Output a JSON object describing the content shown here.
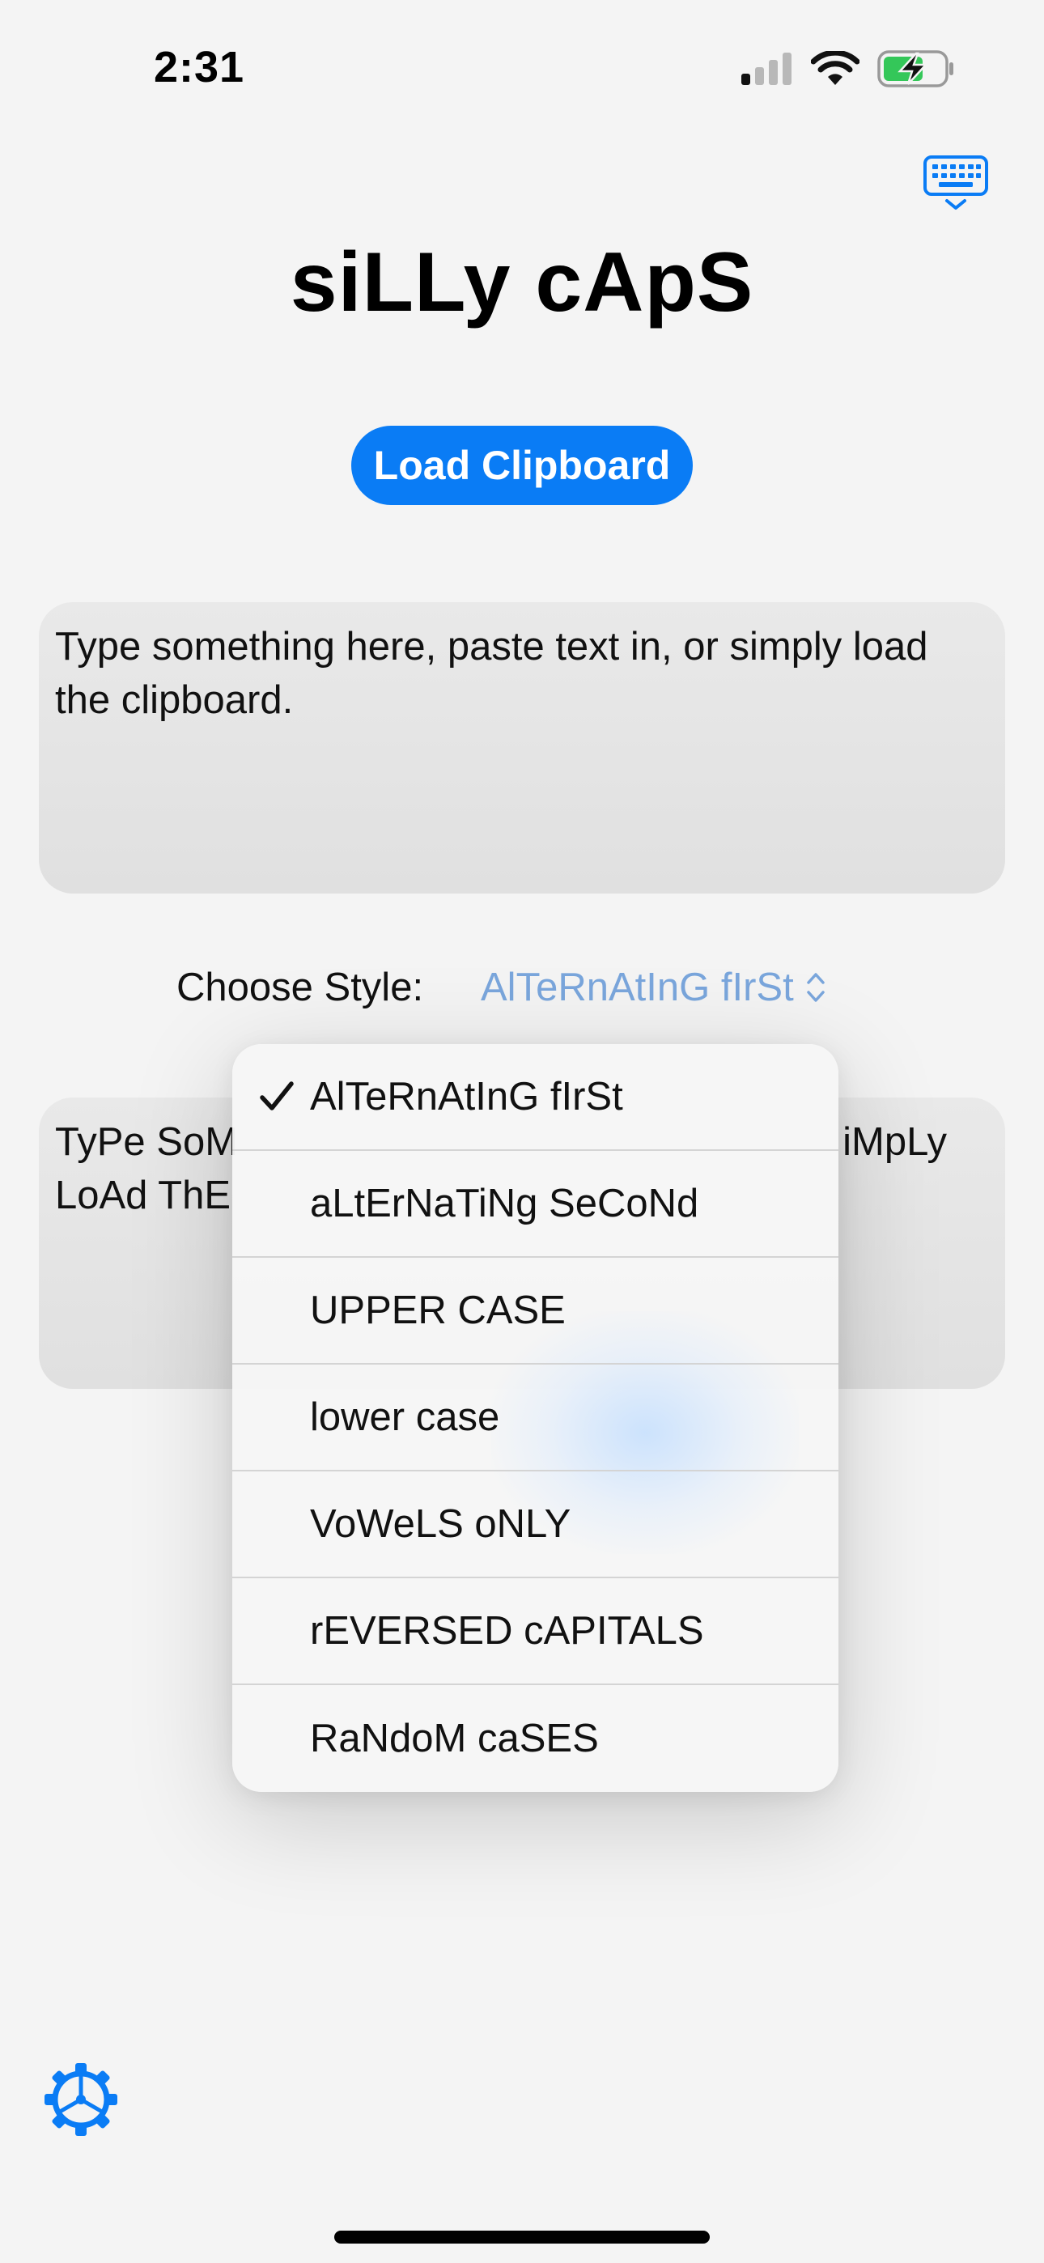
{
  "status_bar": {
    "time": "2:31",
    "icons": [
      "cellular-signal-icon",
      "wifi-icon",
      "battery-charging-icon"
    ]
  },
  "header": {
    "keyboard_icon": "keyboard-toggle-icon",
    "title": "siLLy cApS"
  },
  "load_button": {
    "label": "Load Clipboard"
  },
  "input_box": {
    "text": "Type something here, paste text in, or simply load the clipboard."
  },
  "style_row": {
    "label": "Choose Style:",
    "selected": "AlTeRnAtInG fIrSt",
    "chevron_icon": "chevron-up-down-icon"
  },
  "output_box": {
    "line1_left": "TyPe SoM",
    "line1_right": "iMpLy",
    "line2_left": "LoAd ThE"
  },
  "menu": {
    "selected_index": 0,
    "items": [
      {
        "label": "AlTeRnAtInG fIrSt"
      },
      {
        "label": "aLtErNaTiNg SeCoNd"
      },
      {
        "label": "UPPER CASE"
      },
      {
        "label": "lower case"
      },
      {
        "label": "VoWeLS oNLY"
      },
      {
        "label": "rEVERSED cAPITALS"
      },
      {
        "label": "RaNdoM caSES"
      }
    ]
  },
  "footer": {
    "settings_icon": "gear-icon"
  },
  "colors": {
    "accent": "#0a7cf5",
    "picker_text": "#7aa6dc",
    "background": "#f4f4f4",
    "battery_green": "#34c759"
  }
}
